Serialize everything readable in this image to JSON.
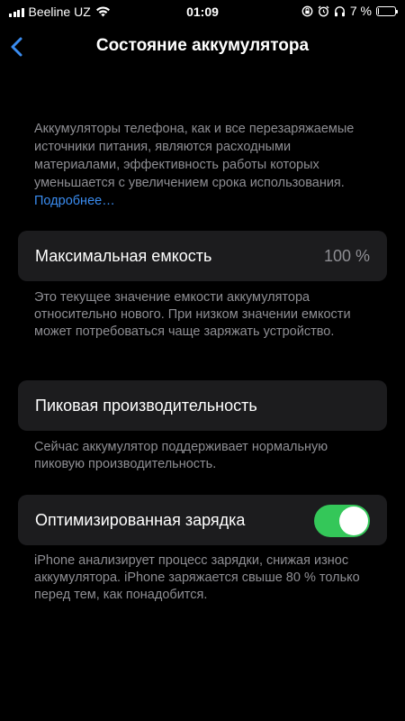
{
  "status_bar": {
    "carrier": "Beeline UZ",
    "time": "01:09",
    "battery_percent": "7 %",
    "battery_level": 0.07,
    "icons": [
      "signal-icon",
      "wifi-icon",
      "orientation-lock-icon",
      "alarm-icon",
      "headphones-icon",
      "battery-icon"
    ]
  },
  "nav": {
    "title": "Состояние аккумулятора",
    "back_icon": "chevron-left-icon"
  },
  "intro": {
    "text": "Аккумуляторы телефона, как и все перезаряжаемые источники питания, являются расходными материалами, эффективность работы которых уменьшается с увеличением срока использования. ",
    "link": "Подробнее…"
  },
  "max_capacity": {
    "label": "Максимальная емкость",
    "value": "100 %",
    "footnote": "Это текущее значение емкости аккумулятора относительно нового. При низком значении емкости может потребоваться чаще заряжать устройство."
  },
  "peak_performance": {
    "label": "Пиковая производительность",
    "footnote": "Сейчас аккумулятор поддерживает нормальную пиковую производительность."
  },
  "optimized_charging": {
    "label": "Оптимизированная зарядка",
    "enabled": true,
    "footnote": "iPhone анализирует процесс зарядки, снижая износ аккумулятора. iPhone заряжается свыше 80 % только перед тем, как понадобится."
  },
  "colors": {
    "background": "#000000",
    "cell": "#1c1c1e",
    "secondary_text": "#8e8e93",
    "link": "#3a8cf0",
    "toggle_on": "#34c759"
  }
}
